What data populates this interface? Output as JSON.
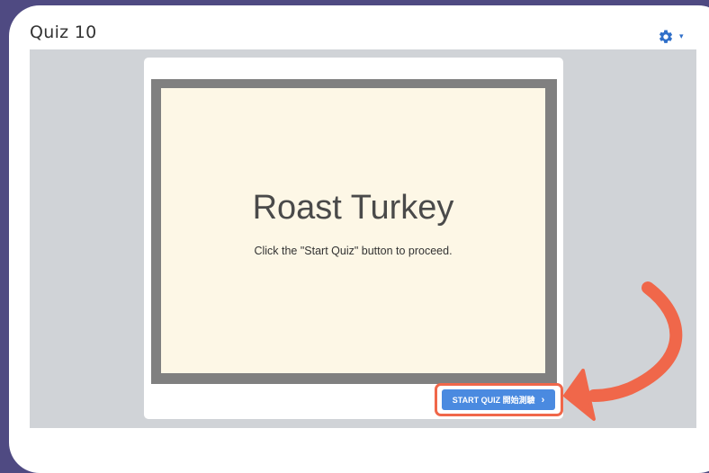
{
  "header": {
    "title": "Quiz 10",
    "settings_icon": "gear-icon",
    "settings_caret": "▾"
  },
  "slide": {
    "title": "Roast Turkey",
    "subtitle": "Click the \"Start Quiz\" button to proceed.",
    "background": "#fdf7e6",
    "border_color": "#808080"
  },
  "start_button": {
    "label": "START QUIZ 開始測驗",
    "chevron": "›",
    "color": "#4a8ae0"
  },
  "annotation": {
    "color": "#f0674a",
    "arrow_icon": "curved-arrow-icon"
  },
  "colors": {
    "page_background": "#4f4a82",
    "viewer_background": "#d0d3d7",
    "accent": "#2f6fc9"
  }
}
